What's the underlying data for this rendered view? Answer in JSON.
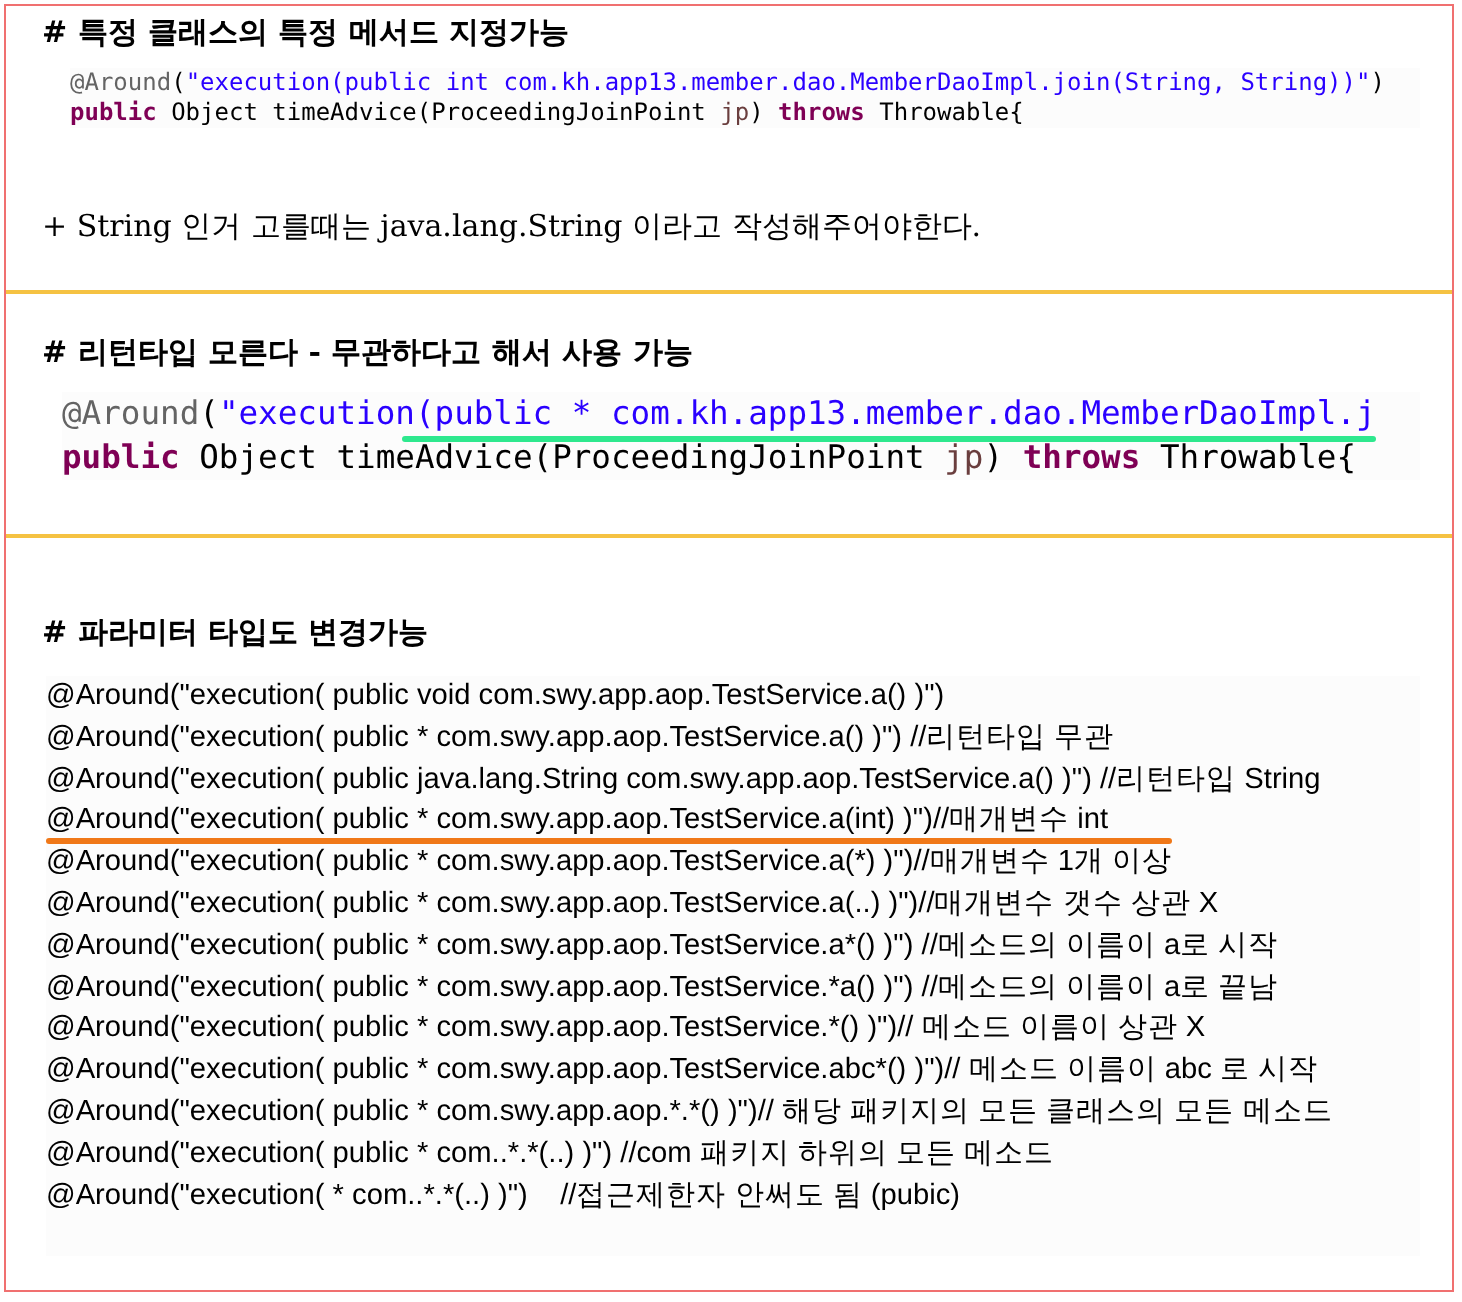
{
  "sections": [
    {
      "heading": "# 특정 클래스의 특정 메서드 지정가능",
      "kind": "small",
      "code": [
        {
          "tokens": [
            {
              "kind": "annotation",
              "text": "@Around"
            },
            {
              "kind": "plain",
              "text": "("
            },
            {
              "kind": "string",
              "text": "\"execution(public int com.kh.app13.member.dao.MemberDaoImpl.join(String, String))\""
            },
            {
              "kind": "plain",
              "text": ")"
            }
          ]
        },
        {
          "tokens": [
            {
              "kind": "keyword",
              "text": "public"
            },
            {
              "kind": "plain",
              "text": " Object timeAdvice(ProceedingJoinPoint "
            },
            {
              "kind": "param",
              "text": "jp"
            },
            {
              "kind": "plain",
              "text": ") "
            },
            {
              "kind": "keyword",
              "text": "throws"
            },
            {
              "kind": "plain",
              "text": " Throwable{"
            }
          ]
        }
      ],
      "note": "+ String 인거 고를때는 java.lang.String 이라고 작성해주어야한다."
    },
    {
      "heading": "# 리턴타입 모른다 - 무관하다고 해서 사용 가능",
      "kind": "large",
      "code": [
        {
          "color": "#2ee88e",
          "tokens": [
            {
              "kind": "annotation",
              "text": "@Around"
            },
            {
              "kind": "plain",
              "text": "("
            },
            {
              "kind": "string",
              "text": "\"execution(public * com.kh.app13.member.dao.MemberDaoImpl.j"
            }
          ]
        },
        {
          "tokens": [
            {
              "kind": "keyword",
              "text": "public"
            },
            {
              "kind": "plain",
              "text": " Object timeAdvice(ProceedingJoinPoint "
            },
            {
              "kind": "param",
              "text": "jp"
            },
            {
              "kind": "plain",
              "text": ") "
            },
            {
              "kind": "keyword",
              "text": "throws"
            },
            {
              "kind": "plain",
              "text": " Throwable{"
            }
          ]
        }
      ]
    },
    {
      "heading": "# 파라미터 타입도 변경가능",
      "kind": "plain",
      "code": [
        {
          "text": "@Around(\"execution( public void com.swy.app.aop.TestService.a() )\")"
        },
        {
          "text": "@Around(\"execution( public * com.swy.app.aop.TestService.a() )\") //리턴타입 무관"
        },
        {
          "text": "@Around(\"execution( public java.lang.String com.swy.app.aop.TestService.a() )\") //리턴타입 String"
        },
        {
          "text": "@Around(\"execution( public * com.swy.app.aop.TestService.a(int) )\")//매개변수 int"
        },
        {
          "color": "#f07818",
          "text": "@Around(\"execution( public * com.swy.app.aop.TestService.a(*) )\")//매개변수 1개 이상"
        },
        {
          "text": "@Around(\"execution( public * com.swy.app.aop.TestService.a(..) )\")//매개변수 갯수 상관 X"
        },
        {
          "text": "@Around(\"execution( public * com.swy.app.aop.TestService.a*() )\") //메소드의 이름이 a로 시작"
        },
        {
          "text": "@Around(\"execution( public * com.swy.app.aop.TestService.*a() )\") //메소드의 이름이 a로 끝남"
        },
        {
          "text": "@Around(\"execution( public * com.swy.app.aop.TestService.*() )\")// 메소드 이름이 상관 X"
        },
        {
          "text": "@Around(\"execution( public * com.swy.app.aop.TestService.abc*() )\")// 메소드 이름이 abc 로 시작"
        },
        {
          "text": "@Around(\"execution( public * com.swy.app.aop.*.*() )\")// 해당 패키지의 모든 클래스의 모든 메소드"
        },
        {
          "text": "@Around(\"execution( public * com..*.*(..) )\") //com 패키지 하위의 모든 메소드"
        },
        {
          "text": "@Around(\"execution( * com..*.*(..) )\")    //접근제한자 안써도 됨 (pubic)"
        }
      ]
    }
  ]
}
